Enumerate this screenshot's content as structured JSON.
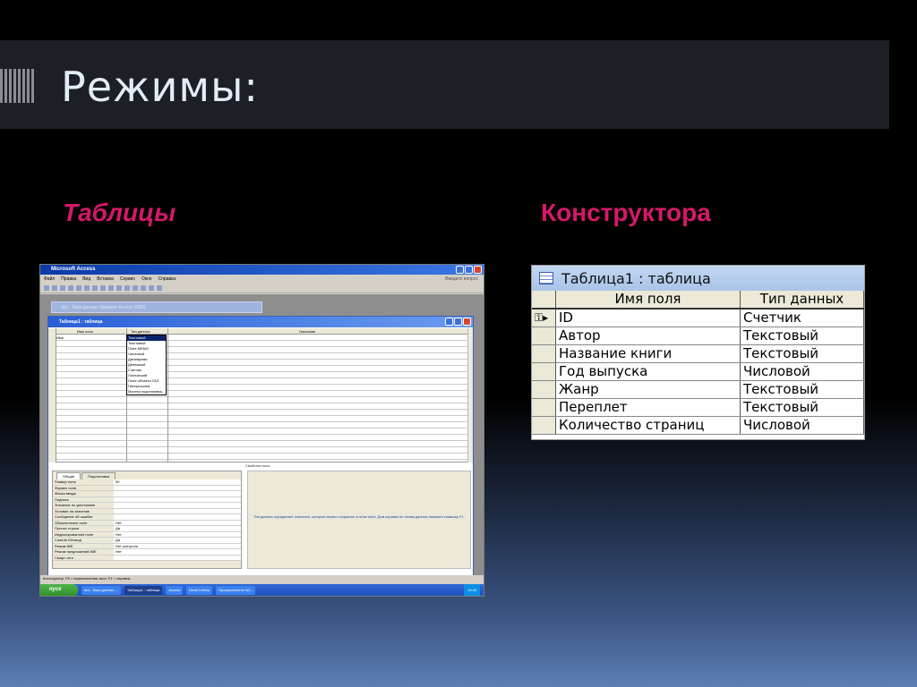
{
  "slide": {
    "title": "Режимы:",
    "left_heading": "Таблицы",
    "right_heading": "Конструктора"
  },
  "access_window": {
    "title": "Microsoft Access",
    "menu": [
      "Файл",
      "Правка",
      "Вид",
      "Вставка",
      "Сервис",
      "Окно",
      "Справка"
    ],
    "help_placeholder": "Введите вопрос",
    "db_window_title": "db1 : база данных (формат Access 2000)",
    "table_window_title": "Таблица1 : таблица",
    "grid_headers": [
      "Имя поля",
      "Тип данных",
      "Описание"
    ],
    "first_row_name": "Имя",
    "type_dropdown": {
      "selected": "Текстовый",
      "options": [
        "Текстовый",
        "Поле MEMO",
        "Числовой",
        "Дата/время",
        "Денежный",
        "Счетчик",
        "Логический",
        "Поле объекта OLE",
        "Гиперссылка",
        "Мастер подстановок..."
      ]
    },
    "properties_label": "Свойства поля",
    "props_tabs": [
      "Общие",
      "Подстановка"
    ],
    "props": [
      {
        "label": "Размер поля",
        "value": "50"
      },
      {
        "label": "Формат поля",
        "value": ""
      },
      {
        "label": "Маска ввода",
        "value": ""
      },
      {
        "label": "Подпись",
        "value": ""
      },
      {
        "label": "Значение по умолчанию",
        "value": ""
      },
      {
        "label": "Условие на значение",
        "value": ""
      },
      {
        "label": "Сообщение об ошибке",
        "value": ""
      },
      {
        "label": "Обязательное поле",
        "value": "Нет"
      },
      {
        "label": "Пустые строки",
        "value": "Да"
      },
      {
        "label": "Индексированное поле",
        "value": "Нет"
      },
      {
        "label": "Сжатие Юникод",
        "value": "Да"
      },
      {
        "label": "Режим IME",
        "value": "Нет контроля"
      },
      {
        "label": "Режим предложений IME",
        "value": "Нет"
      },
      {
        "label": "Смарт-теги",
        "value": ""
      }
    ],
    "help_text": "Тип данных определяет значения, которые можно сохранять в этом поле. Для справки по типам данных нажмите клавишу F1.",
    "status_text": "Конструктор. F6 = переключение окон. F1 = справка.",
    "taskbar": {
      "start": "пуск",
      "buttons": [
        "db1 : база данных ...",
        "Таблица1 : таблица",
        "Access",
        "Dead Letters",
        "Проигрыватель Wi..."
      ],
      "clock": "19:45"
    }
  },
  "design_view": {
    "title": "Таблица1 : таблица",
    "headers": [
      "Имя поля",
      "Тип данных"
    ],
    "rows": [
      {
        "name": "ID",
        "type": "Счетчик"
      },
      {
        "name": "Автор",
        "type": "Текстовый"
      },
      {
        "name": "Название книги",
        "type": "Текстовый"
      },
      {
        "name": "Год выпуска",
        "type": "Числовой"
      },
      {
        "name": "Жанр",
        "type": "Текстовый"
      },
      {
        "name": "Переплет",
        "type": "Текстовый"
      },
      {
        "name": "Количество страниц",
        "type": "Числовой"
      }
    ]
  }
}
